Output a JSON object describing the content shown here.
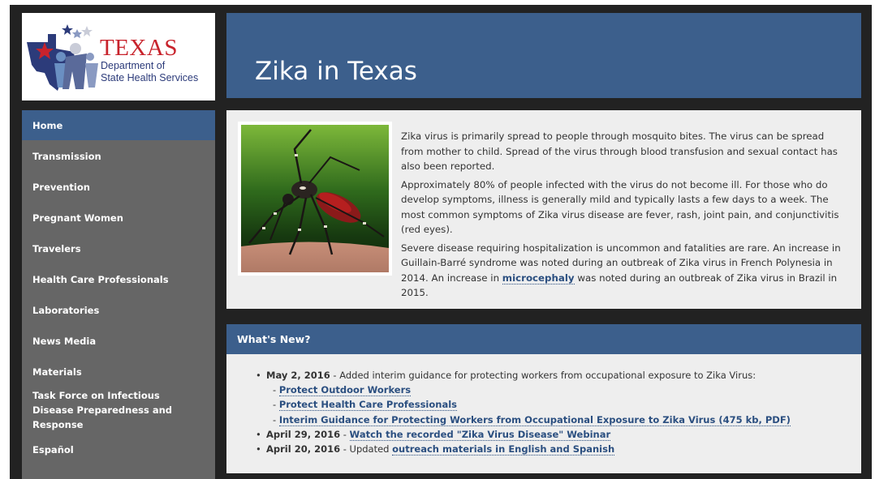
{
  "logo": {
    "texas": "TEXAS",
    "line1": "Department of",
    "line2": "State Health Services"
  },
  "header": {
    "title": "Zika in Texas"
  },
  "sidebar": {
    "items": [
      {
        "label": "Home",
        "active": true
      },
      {
        "label": "Transmission"
      },
      {
        "label": "Prevention"
      },
      {
        "label": "Pregnant Women"
      },
      {
        "label": "Travelers"
      },
      {
        "label": "Health Care Professionals"
      },
      {
        "label": "Laboratories"
      },
      {
        "label": "News Media"
      },
      {
        "label": "Materials"
      },
      {
        "label": "Task Force on Infectious Disease Preparedness and Response"
      },
      {
        "label": "Español"
      }
    ]
  },
  "intro": {
    "p1": "Zika virus is primarily spread to people through mosquito bites. The virus can be spread from mother to child. Spread of the virus through blood transfusion and sexual contact has also been reported.",
    "p2": "Approximately 80% of people infected with the virus do not become ill. For those who do develop symptoms, illness is generally mild and typically lasts a few days to a week. The most common symptoms of Zika virus disease are fever, rash, joint pain, and conjunctivitis (red eyes).",
    "p3_before": "Severe disease requiring hospitalization is uncommon and fatalities are rare. An increase in Guillain-Barré syndrome was noted during an outbreak of Zika virus in French Polynesia in 2014. An increase in ",
    "p3_link": "microcephaly",
    "p3_after": " was noted during an outbreak of Zika virus in Brazil in 2015."
  },
  "news": {
    "title": "What's New?",
    "item1": {
      "date": "May 2, 2016",
      "text": " - Added interim guidance for protecting workers from occupational exposure to Zika Virus:",
      "links": [
        "Protect Outdoor Workers",
        "Protect Health Care Professionals",
        "Interim Guidance for Protecting Workers from Occupational Exposure to Zika Virus (475 kb, PDF)"
      ]
    },
    "item2": {
      "date": "April 29, 2016",
      "text": " - ",
      "link": "Watch the recorded \"Zika Virus Disease\" Webinar"
    },
    "item3": {
      "date": "April 20, 2016",
      "text": " - Updated ",
      "link": "outreach materials in English and Spanish"
    }
  },
  "colors": {
    "primary": "#3c5f8c",
    "sidebar": "#666666",
    "panel": "#eeeeee",
    "frame": "#222222",
    "texas_red": "#c8232c"
  }
}
